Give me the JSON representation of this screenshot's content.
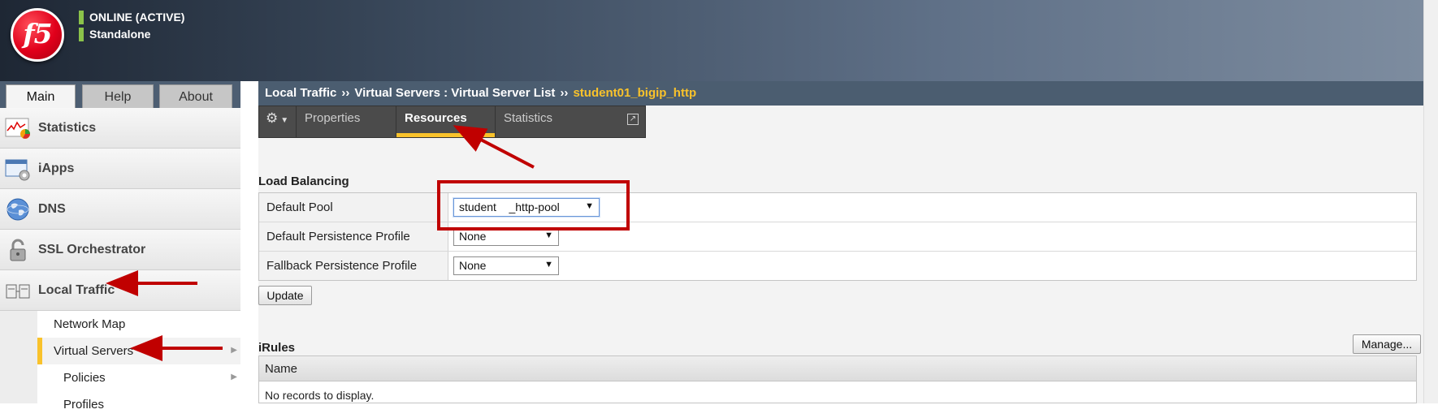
{
  "header": {
    "logo_text": "f5",
    "status_line1": "ONLINE (ACTIVE)",
    "status_line2": "Standalone",
    "status_color": "#8bc34a"
  },
  "left_tabs": [
    {
      "label": "Main",
      "active": true
    },
    {
      "label": "Help",
      "active": false
    },
    {
      "label": "About",
      "active": false
    }
  ],
  "sidebar": {
    "items": [
      {
        "label": "Statistics",
        "icon": "statistics-chart-icon"
      },
      {
        "label": "iApps",
        "icon": "iapps-window-gear-icon"
      },
      {
        "label": "DNS",
        "icon": "globe-icon"
      },
      {
        "label": "SSL Orchestrator",
        "icon": "padlock-icon"
      },
      {
        "label": "Local Traffic",
        "icon": "local-traffic-icon"
      }
    ],
    "subitems": [
      {
        "label": "Network Map",
        "selected": false
      },
      {
        "label": "Virtual Servers",
        "selected": true
      },
      {
        "label": "Policies",
        "selected": false
      },
      {
        "label": "Profiles",
        "selected": false
      }
    ]
  },
  "breadcrumb": {
    "part1": "Local Traffic",
    "part2": "Virtual Servers : Virtual Server List",
    "current": "student01_bigip_http",
    "separator": "››"
  },
  "tabs": [
    {
      "label": "Properties",
      "active": false
    },
    {
      "label": "Resources",
      "active": true
    },
    {
      "label": "Statistics",
      "active": false
    }
  ],
  "load_balancing": {
    "title": "Load Balancing",
    "rows": [
      {
        "label": "Default Pool",
        "value": "student    _http-pool"
      },
      {
        "label": "Default Persistence Profile",
        "value": "None"
      },
      {
        "label": "Fallback Persistence Profile",
        "value": "None"
      }
    ],
    "update_label": "Update"
  },
  "irules": {
    "title": "iRules",
    "manage_label": "Manage...",
    "column_header": "Name",
    "empty_text": "No records to display."
  },
  "colors": {
    "accent": "#f9c22b",
    "annotation_red": "#c00000",
    "header_dark": "#4b5d70"
  }
}
